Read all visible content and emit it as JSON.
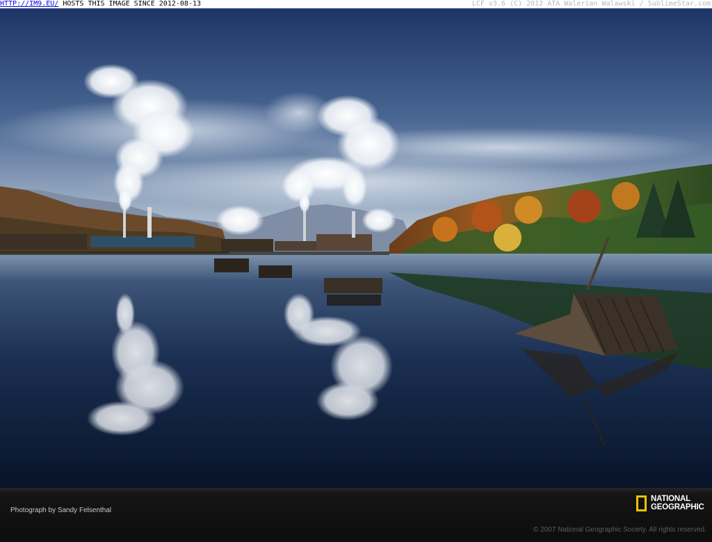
{
  "topbar": {
    "link": "HTTP://IM9.EU/",
    "host_text": " HOSTS THIS IMAGE SINCE 2012-08-13",
    "right_text": "LCF v3.6 (C) 2012 ATA Walerian Walawski / SublimeStar.com"
  },
  "photo": {
    "subject": "paper mill smokestacks reflected in a calm river with autumn hillside"
  },
  "footer": {
    "credit": "Photograph by Sandy Felsenthal",
    "logo_line1": "NATIONAL",
    "logo_line2": "GEOGRAPHIC",
    "copyright": "© 2007 National Geographic Society. All rights reserved."
  },
  "colors": {
    "sky_top": "#1f3a6e",
    "sky_horizon": "#b9c6d6",
    "water_dark": "#0b1a33",
    "logo_yellow": "#f2c200"
  }
}
